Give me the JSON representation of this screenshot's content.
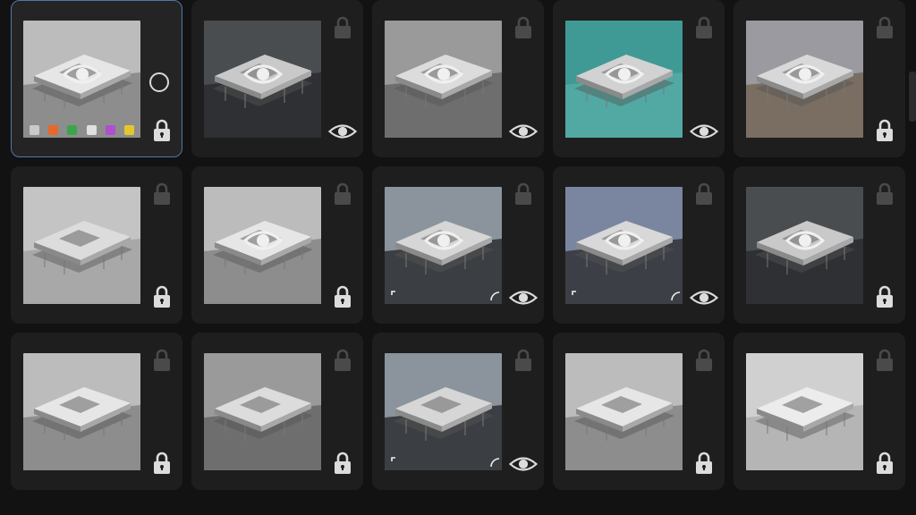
{
  "grid": {
    "rows": [
      [
        {
          "id": "r0c0",
          "tone": "light",
          "lock": "top"
        },
        {
          "id": "r0c1",
          "tone": "light",
          "lock": "top"
        },
        {
          "id": "r0c2",
          "tone": "light",
          "lock": "top"
        },
        {
          "id": "r0c3",
          "tone": "light",
          "lock": "top"
        },
        {
          "id": "r0c4",
          "tone": "light",
          "lock": "top"
        }
      ],
      [
        {
          "id": "r1c0",
          "tone": "light",
          "selected": true,
          "eye_overlay": true,
          "side": "circle",
          "lock": "bottom",
          "apps": true
        },
        {
          "id": "r1c1",
          "tone": "dark",
          "eye_overlay": true,
          "lock": "top",
          "side": "eye"
        },
        {
          "id": "r1c2",
          "tone": "grey",
          "eye_overlay": true,
          "lock": "top",
          "side": "eye"
        },
        {
          "id": "r1c3",
          "tone": "teal",
          "eye_overlay": true,
          "lock": "top",
          "side": "eye"
        },
        {
          "id": "r1c4",
          "tone": "warm",
          "eye_overlay": true,
          "lock": "top",
          "side": "lock"
        }
      ],
      [
        {
          "id": "r2c0",
          "tone": "plain",
          "lock": "top",
          "side": "lock"
        },
        {
          "id": "r2c1",
          "tone": "light",
          "eye_overlay": true,
          "lock": "top",
          "side": "lock"
        },
        {
          "id": "r2c2",
          "tone": "dusk",
          "eye_overlay": true,
          "lock": "top",
          "side": "eye",
          "corner": true
        },
        {
          "id": "r2c3",
          "tone": "dusk2",
          "eye_overlay": true,
          "lock": "top",
          "side": "eye",
          "corner": true
        },
        {
          "id": "r2c4",
          "tone": "dark",
          "eye_overlay": true,
          "lock": "top",
          "side": "lock"
        }
      ],
      [
        {
          "id": "r3c0",
          "tone": "light",
          "lock": "top",
          "side": "lock"
        },
        {
          "id": "r3c1",
          "tone": "grey",
          "lock": "top",
          "side": "lock"
        },
        {
          "id": "r3c2",
          "tone": "dusk",
          "lock": "top",
          "side": "eye",
          "corner": true
        },
        {
          "id": "r3c3",
          "tone": "light",
          "lock": "top",
          "side": "lock"
        },
        {
          "id": "r3c4",
          "tone": "pale",
          "lock": "top",
          "side": "lock"
        }
      ]
    ]
  },
  "app_icons": [
    "#c9c9c9",
    "#e8682a",
    "#3aa64a",
    "#e0e0e0",
    "#b04fd0",
    "#e3c72b"
  ],
  "tones": {
    "light": {
      "sky": "#bcbcbc",
      "ground": "#8d8d8d",
      "slab": "#e6e6e6"
    },
    "dark": {
      "sky": "#4a4d50",
      "ground": "#2e3033",
      "slab": "#c9c9c9"
    },
    "grey": {
      "sky": "#9a9a9a",
      "ground": "#6e6e6e",
      "slab": "#dcdcdc"
    },
    "teal": {
      "sky": "#3f9a96",
      "ground": "#52a9a3",
      "slab": "#d2d2d2"
    },
    "warm": {
      "sky": "#9a9aa0",
      "ground": "#7a6e62",
      "slab": "#d8d8d8"
    },
    "plain": {
      "sky": "#c4c4c4",
      "ground": "#a8a8a8",
      "slab": "#dcdcdc"
    },
    "dusk": {
      "sky": "#8b949c",
      "ground": "#3b3e42",
      "slab": "#d6d6d6"
    },
    "dusk2": {
      "sky": "#7a86a0",
      "ground": "#3d3f46",
      "slab": "#d8d8d8"
    },
    "pale": {
      "sky": "#d0d0d0",
      "ground": "#b5b5b5",
      "slab": "#ececec"
    }
  }
}
